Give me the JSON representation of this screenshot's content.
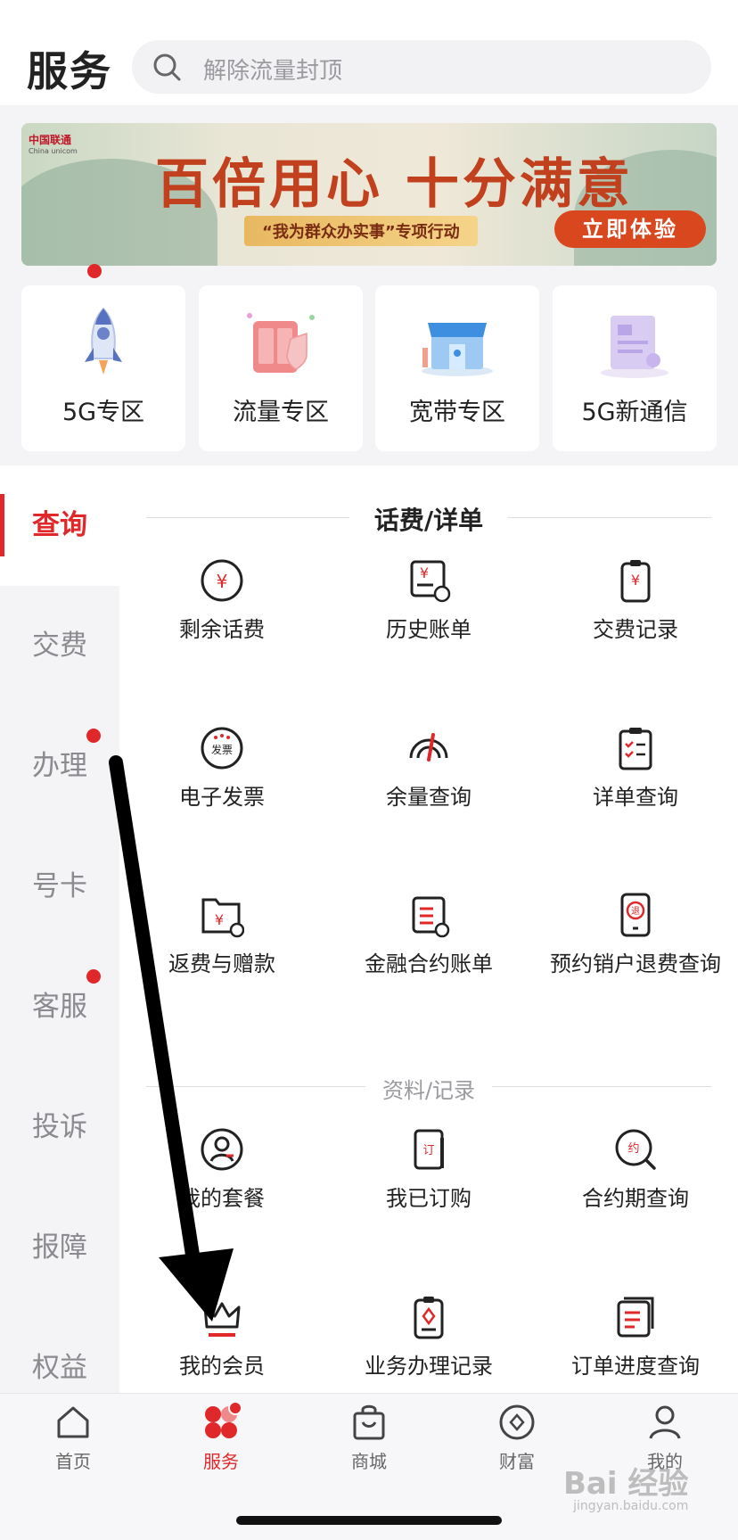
{
  "header": {
    "title": "服务",
    "search_placeholder": "解除流量封顶"
  },
  "banner": {
    "logo_cn": "中国联通",
    "logo_en": "China unicom",
    "slogan": "百倍用心 十分满意",
    "subtitle": "“我为群众办实事”专项行动",
    "cta": "立即体验"
  },
  "zones": [
    {
      "label": "5G专区",
      "icon": "rocket-icon"
    },
    {
      "label": "流量专区",
      "icon": "data-package-icon"
    },
    {
      "label": "宽带专区",
      "icon": "broadband-store-icon"
    },
    {
      "label": "5G新通信",
      "icon": "message-document-icon"
    }
  ],
  "left_nav": [
    {
      "label": "查询",
      "active": true,
      "badge": false
    },
    {
      "label": "交费",
      "active": false,
      "badge": false
    },
    {
      "label": "办理",
      "active": false,
      "badge": true
    },
    {
      "label": "号卡",
      "active": false,
      "badge": false
    },
    {
      "label": "客服",
      "active": false,
      "badge": true
    },
    {
      "label": "投诉",
      "active": false,
      "badge": false
    },
    {
      "label": "报障",
      "active": false,
      "badge": false
    },
    {
      "label": "权益",
      "active": false,
      "badge": false
    }
  ],
  "sections": [
    {
      "title": "话费/详单",
      "items": [
        {
          "label": "剩余话费",
          "icon": "yuan-circle-icon"
        },
        {
          "label": "历史账单",
          "icon": "bill-history-icon"
        },
        {
          "label": "交费记录",
          "icon": "payment-record-icon"
        },
        {
          "label": "电子发票",
          "icon": "e-invoice-icon"
        },
        {
          "label": "余量查询",
          "icon": "gauge-icon"
        },
        {
          "label": "详单查询",
          "icon": "checklist-icon"
        },
        {
          "label": "返费与赠款",
          "icon": "refund-folder-icon"
        },
        {
          "label": "金融合约账单",
          "icon": "contract-bill-icon"
        },
        {
          "label": "预约销户退费查询",
          "icon": "phone-refund-icon"
        }
      ]
    },
    {
      "title": "资料/记录",
      "items": [
        {
          "label": "我的套餐",
          "icon": "user-circle-icon"
        },
        {
          "label": "我已订购",
          "icon": "order-icon"
        },
        {
          "label": "合约期查询",
          "icon": "contract-search-icon"
        },
        {
          "label": "我的会员",
          "icon": "crown-icon"
        },
        {
          "label": "业务办理记录",
          "icon": "service-record-icon"
        },
        {
          "label": "订单进度查询",
          "icon": "order-progress-icon"
        }
      ]
    }
  ],
  "tabbar": [
    {
      "label": "首页",
      "icon": "home-icon",
      "active": false
    },
    {
      "label": "服务",
      "icon": "service-grid-icon",
      "active": true
    },
    {
      "label": "商城",
      "icon": "shopping-bag-icon",
      "active": false
    },
    {
      "label": "财富",
      "icon": "wealth-diamond-icon",
      "active": false
    },
    {
      "label": "我的",
      "icon": "profile-icon",
      "active": false
    }
  ],
  "watermark": {
    "brand": "Bai 经验",
    "url": "jingyan.baidu.com"
  },
  "colors": {
    "accent": "#e0282a",
    "text": "#222222",
    "muted": "#8a8a8f",
    "bg_gray": "#f4f4f6"
  }
}
